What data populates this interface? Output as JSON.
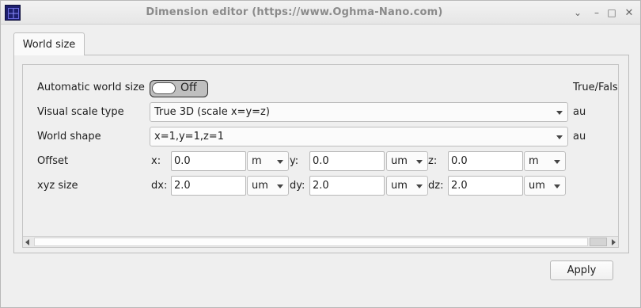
{
  "window": {
    "title": "Dimension editor (https://www.Oghma-Nano.com)",
    "buttons": {
      "pin": "✕",
      "minimize": "⌄",
      "maximize": "▢",
      "close": "✕"
    }
  },
  "tabs": [
    {
      "label": "World size"
    }
  ],
  "form": {
    "automatic_world_size": {
      "label": "Automatic world size",
      "state": "Off",
      "unit": "True/False"
    },
    "visual_scale_type": {
      "label": "Visual scale type",
      "value": "True 3D (scale x=y=z)",
      "unit": "au"
    },
    "world_shape": {
      "label": "World shape",
      "value": "x=1,y=1,z=1",
      "unit": "au"
    },
    "offset": {
      "label": "Offset",
      "x": {
        "label": "x:",
        "value": "0.0",
        "unit": "m"
      },
      "y": {
        "label": "y:",
        "value": "0.0",
        "unit": "um"
      },
      "z": {
        "label": "z:",
        "value": "0.0",
        "unit": "m"
      }
    },
    "xyz_size": {
      "label": "xyz size",
      "dx": {
        "label": "dx:",
        "value": "2.0",
        "unit": "um"
      },
      "dy": {
        "label": "dy:",
        "value": "2.0",
        "unit": "um"
      },
      "dz": {
        "label": "dz:",
        "value": "2.0",
        "unit": "um"
      }
    }
  },
  "actions": {
    "apply_label": "Apply"
  }
}
